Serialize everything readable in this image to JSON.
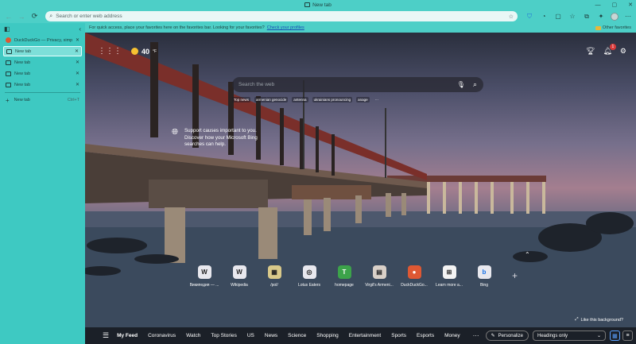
{
  "window": {
    "title": "New tab",
    "controls": [
      "—",
      "▢",
      "✕"
    ]
  },
  "toolbar": {
    "address_placeholder": "Search or enter web address"
  },
  "favorites_bar": {
    "message": "For quick access, place your favorites here on the favorites bar. Looking for your favorites?",
    "link": "Check your profiles",
    "other": "Other favorites"
  },
  "sidebar": {
    "tabs": [
      {
        "label": "DuckDuckGo — Privacy, simplified.",
        "icon": "duckduckgo-icon",
        "active": false
      },
      {
        "label": "New tab",
        "icon": "page-icon",
        "active": true
      },
      {
        "label": "New tab",
        "icon": "page-icon",
        "active": false
      },
      {
        "label": "New tab",
        "icon": "page-icon",
        "active": false
      },
      {
        "label": "New tab",
        "icon": "page-icon",
        "active": false
      }
    ],
    "new_tab": {
      "label": "New tab",
      "shortcut": "Ctrl+T"
    }
  },
  "newtab": {
    "weather": {
      "temp": "40",
      "unit": "°F"
    },
    "notifications_count": "1",
    "search_placeholder": "Search the web",
    "trending": [
      "Top news",
      "armenian genocide",
      "antenna",
      "ukrainians pronouncing",
      "anage"
    ],
    "trending_more": "···",
    "support_text": "Support causes important to you. Discover how your Microsoft Bing searches can help.",
    "quick_links": [
      {
        "label": "Википедия — ...",
        "glyph": "W"
      },
      {
        "label": "Wikipedia",
        "glyph": "W"
      },
      {
        "label": "/pol/",
        "glyph": "▦"
      },
      {
        "label": "Lotus Eaters",
        "glyph": "◎"
      },
      {
        "label": "homepage",
        "glyph": "T"
      },
      {
        "label": "Virgil's Armeni...",
        "glyph": "▤"
      },
      {
        "label": "DuckDuckGo...",
        "glyph": "●"
      },
      {
        "label": "Learn more a...",
        "glyph": "⊞"
      },
      {
        "label": "Bing",
        "glyph": "b"
      }
    ],
    "like_bg": "Like this background?"
  },
  "feed": {
    "items": [
      "My Feed",
      "Coronavirus",
      "Watch",
      "Top Stories",
      "US",
      "News",
      "Science",
      "Shopping",
      "Entertainment",
      "Sports",
      "Esports",
      "Money"
    ],
    "more": "···",
    "personalize": "Personalize",
    "headings": "Headings only"
  },
  "colors": {
    "chrome": "#4dcfc7",
    "sidebar": "#3ec9c2",
    "feedbar": "#191c24"
  }
}
